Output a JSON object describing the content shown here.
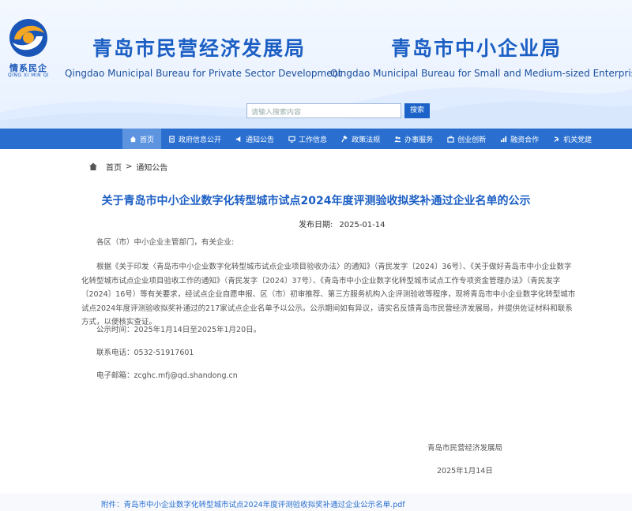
{
  "header": {
    "logo_text": "情系民企",
    "logo_sub": "QING XI MIN QI",
    "org_left_cn": "青岛市民营经济发展局",
    "org_left_en": "Qingdao Municipal Bureau for Private Sector Development",
    "org_right_cn": "青岛市中小企业局",
    "org_right_en": "Qingdao Municipal Bureau for Small and Medium-sized Enterprises",
    "search_placeholder": "请输入搜索内容",
    "search_button": "搜索"
  },
  "nav": {
    "items": [
      {
        "label": "首页",
        "icon": "home-icon",
        "active": true
      },
      {
        "label": "政府信息公开",
        "icon": "document-icon"
      },
      {
        "label": "通知公告",
        "icon": "speaker-icon"
      },
      {
        "label": "工作信息",
        "icon": "monitor-icon"
      },
      {
        "label": "政策法规",
        "icon": "gavel-icon"
      },
      {
        "label": "办事服务",
        "icon": "people-icon"
      },
      {
        "label": "创业创新",
        "icon": "briefcase-icon"
      },
      {
        "label": "融资合作",
        "icon": "chart-icon"
      },
      {
        "label": "机关党建",
        "icon": "party-icon"
      }
    ]
  },
  "breadcrumb": {
    "home": "首页",
    "separator": ">",
    "current": "通知公告"
  },
  "article": {
    "title": "关于青岛市中小企业数字化转型城市试点2024年度评测验收拟奖补通过企业名单的公示",
    "date_label": "发布日期:",
    "date_value": "2025-01-14",
    "greeting": "各区（市）中小企业主管部门，有关企业:",
    "body": "根据《关于印发〈青岛市中小企业数字化转型城市试点企业项目验收办法〉的通知》（青民发字〔2024〕36号）、《关于做好青岛市中小企业数字化转型城市试点企业项目验收工作的通知》（青民发字〔2024〕37号）、《青岛市中小企业数字化转型城市试点工作专项资金管理办法》（青民发字〔2024〕16号）等有关要求，经试点企业自愿申报、区（市）初审推荐、第三方服务机构入企评测验收等程序，现将青岛市中小企业数字化转型城市试点2024年度评测验收拟奖补通过的217家试点企业名单予以公示。公示期间如有异议，请实名反馈青岛市民营经济发展局，并提供佐证材料和联系方式，以便核实查证。",
    "notice_time": "公示时间：2025年1月14日至2025年1月20日。",
    "phone": "联系电话：0532-51917601",
    "email": "电子邮箱：zcghc.mfj@qd.shandong.cn",
    "sign_org": "青岛市民营经济发展局",
    "sign_date": "2025年1月14日",
    "attachment": "附件：青岛市中小企业数字化转型城市试点2024年度评测验收拟奖补通过企业公示名单.pdf"
  },
  "colors": {
    "brand_blue": "#1c5fc4",
    "nav_blue": "#2a6fd0",
    "nav_active": "#5d94e0",
    "logo_orange": "#f5a623"
  }
}
